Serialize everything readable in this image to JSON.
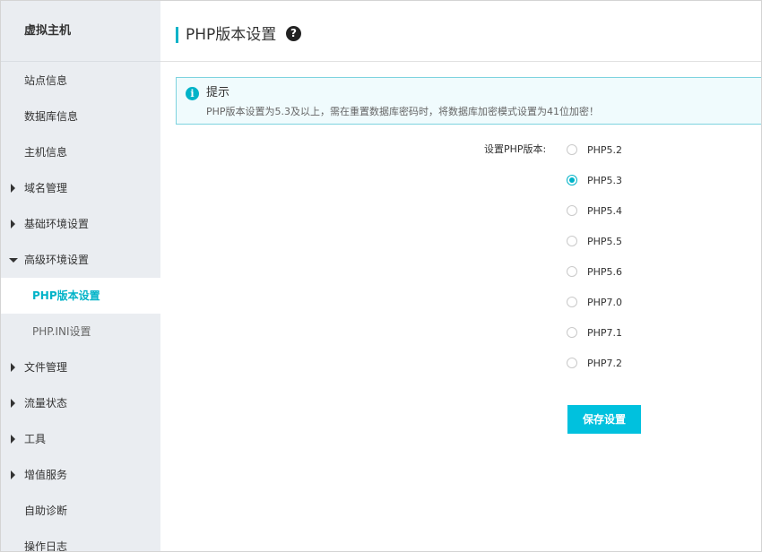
{
  "sidebar": {
    "title": "虚拟主机",
    "items": [
      {
        "label": "站点信息"
      },
      {
        "label": "数据库信息"
      },
      {
        "label": "主机信息"
      },
      {
        "label": "域名管理"
      },
      {
        "label": "基础环境设置"
      },
      {
        "label": "高级环境设置"
      },
      {
        "label": "PHP版本设置"
      },
      {
        "label": "PHP.INI设置"
      },
      {
        "label": "文件管理"
      },
      {
        "label": "流量状态"
      },
      {
        "label": "工具"
      },
      {
        "label": "增值服务"
      },
      {
        "label": "自助诊断"
      },
      {
        "label": "操作日志"
      }
    ]
  },
  "header": {
    "title": "PHP版本设置",
    "help_icon": "?"
  },
  "tip": {
    "icon": "i",
    "title": "提示",
    "text": "PHP版本设置为5.3及以上，需在重置数据库密码时，将数据库加密模式设置为41位加密！"
  },
  "form": {
    "label": "设置PHP版本:",
    "options": [
      "PHP5.2",
      "PHP5.3",
      "PHP5.4",
      "PHP5.5",
      "PHP5.6",
      "PHP7.0",
      "PHP7.1",
      "PHP7.2"
    ],
    "selected": "PHP5.3",
    "save_label": "保存设置"
  },
  "colors": {
    "accent": "#00b3c8",
    "button": "#00c1de",
    "sidebar_bg": "#eaedf1"
  }
}
